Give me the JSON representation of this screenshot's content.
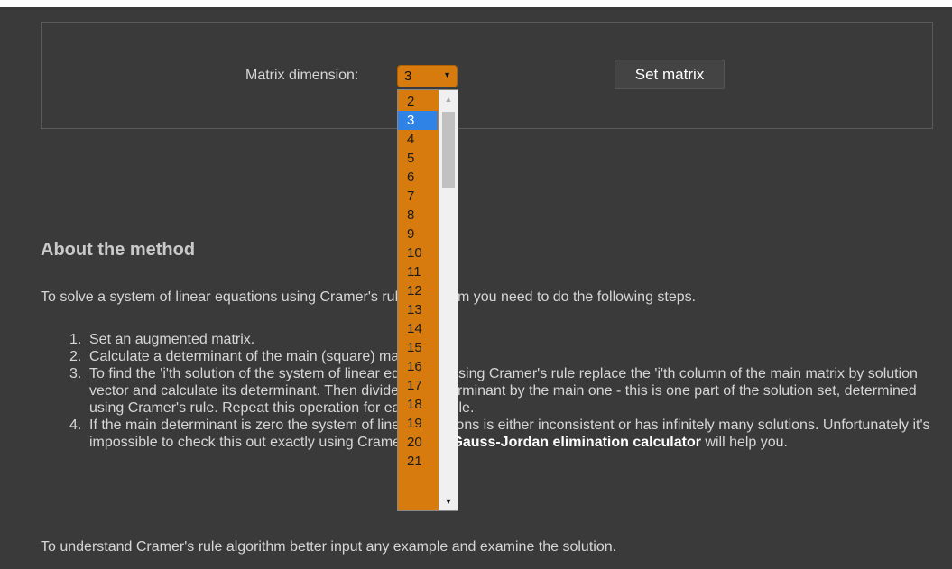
{
  "matrix": {
    "label": "Matrix dimension:",
    "selected_value": "3",
    "set_button": "Set matrix",
    "options": [
      "2",
      "3",
      "4",
      "5",
      "6",
      "7",
      "8",
      "9",
      "10",
      "11",
      "12",
      "13",
      "14",
      "15",
      "16",
      "17",
      "18",
      "19",
      "20",
      "21"
    ],
    "selected_option": "3"
  },
  "about": {
    "heading": "About the method",
    "intro": "To solve a system of linear equations using Cramer's rule algorithm you need to do the following steps.",
    "steps": [
      {
        "num": "1.",
        "text": "Set an augmented matrix."
      },
      {
        "num": "2.",
        "text": "Calculate a determinant of the main (square) matrix."
      },
      {
        "num": "3.",
        "text": "To find the 'i'th solution of the system of linear equations using Cramer's rule replace the 'i'th column of the main matrix by solution vector and calculate its determinant. Then divide this determinant by the main one - this is one part of the solution set, determined using Cramer's rule. Repeat this operation for each variable."
      },
      {
        "num": "4.",
        "text_before": "If the main determinant is zero the system of linear equations is either inconsistent or has infinitely many solutions. Unfortunately it's impossible to check this out exactly using Cramer's rule. ",
        "link": "Gauss-Jordan elimination calculator",
        "text_after": " will help you."
      }
    ],
    "outro": "To understand Cramer's rule algorithm better input any example and examine the solution."
  },
  "colors": {
    "background": "#3a3a3a",
    "select_accent": "#d87b0e",
    "highlight": "#2f83e6"
  }
}
